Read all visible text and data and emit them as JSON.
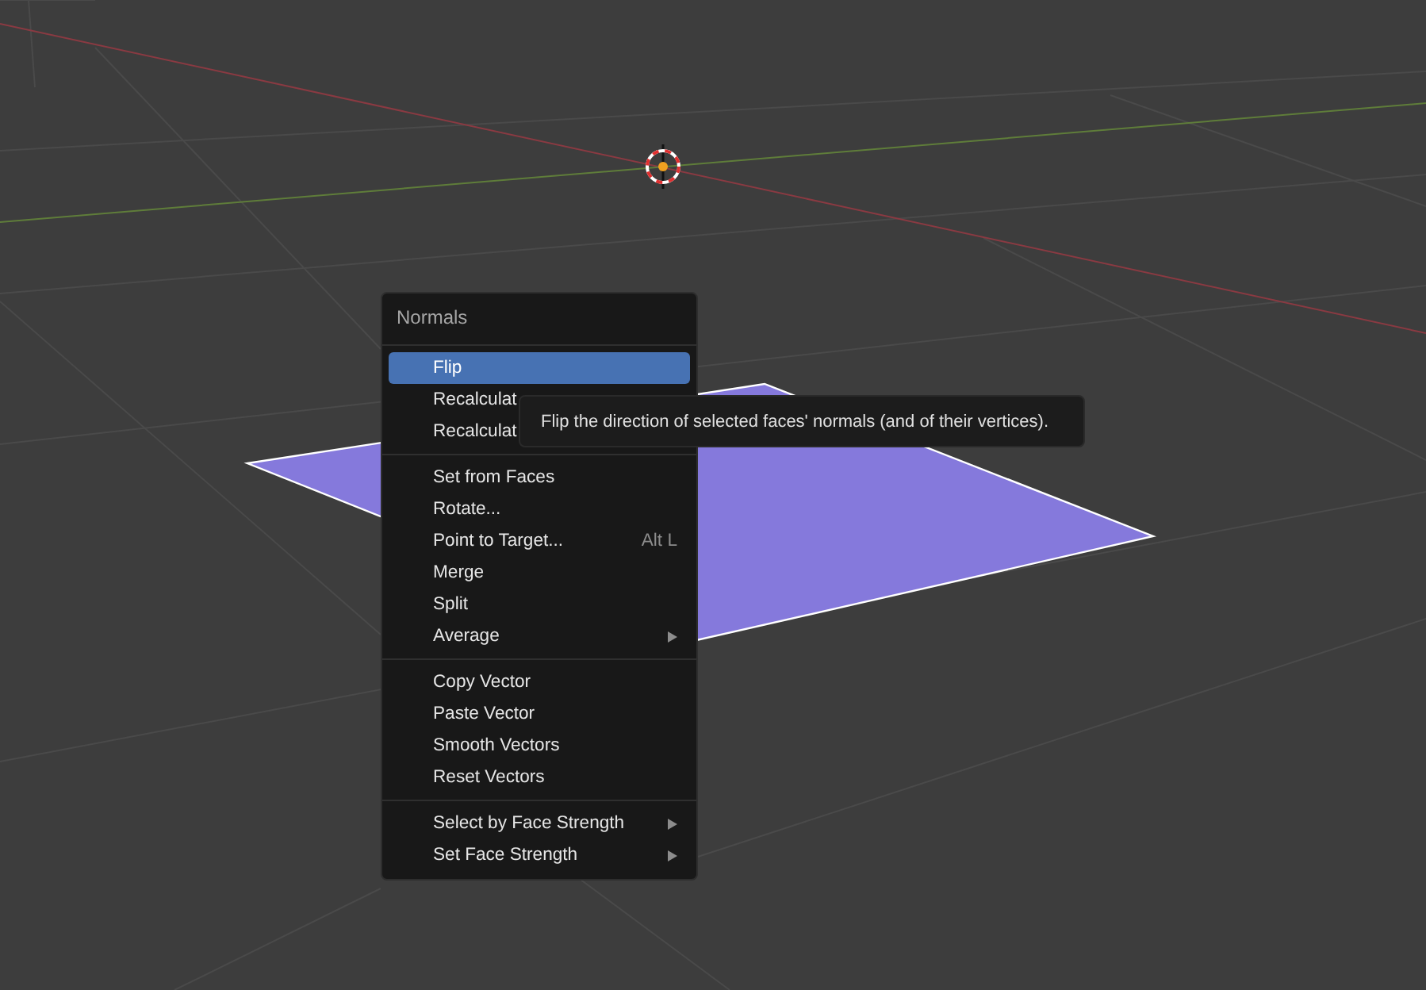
{
  "menu": {
    "title": "Normals",
    "sections": [
      {
        "items": [
          {
            "label": "Flip",
            "selected": true
          },
          {
            "label": "Recalculat",
            "selected": false
          },
          {
            "label": "Recalculat",
            "selected": false
          }
        ]
      },
      {
        "items": [
          {
            "label": "Set from Faces",
            "selected": false
          },
          {
            "label": "Rotate...",
            "selected": false
          },
          {
            "label": "Point to Target...",
            "shortcut": "Alt L",
            "selected": false
          },
          {
            "label": "Merge",
            "selected": false
          },
          {
            "label": "Split",
            "selected": false
          },
          {
            "label": "Average",
            "submenu": true,
            "selected": false
          }
        ]
      },
      {
        "items": [
          {
            "label": "Copy Vector",
            "selected": false
          },
          {
            "label": "Paste Vector",
            "selected": false
          },
          {
            "label": "Smooth Vectors",
            "selected": false
          },
          {
            "label": "Reset Vectors",
            "selected": false
          }
        ]
      },
      {
        "items": [
          {
            "label": "Select by Face Strength",
            "submenu": true,
            "selected": false
          },
          {
            "label": "Set Face Strength",
            "submenu": true,
            "selected": false
          }
        ]
      }
    ]
  },
  "tooltip": "Flip the direction of selected faces' normals (and of their vertices)."
}
